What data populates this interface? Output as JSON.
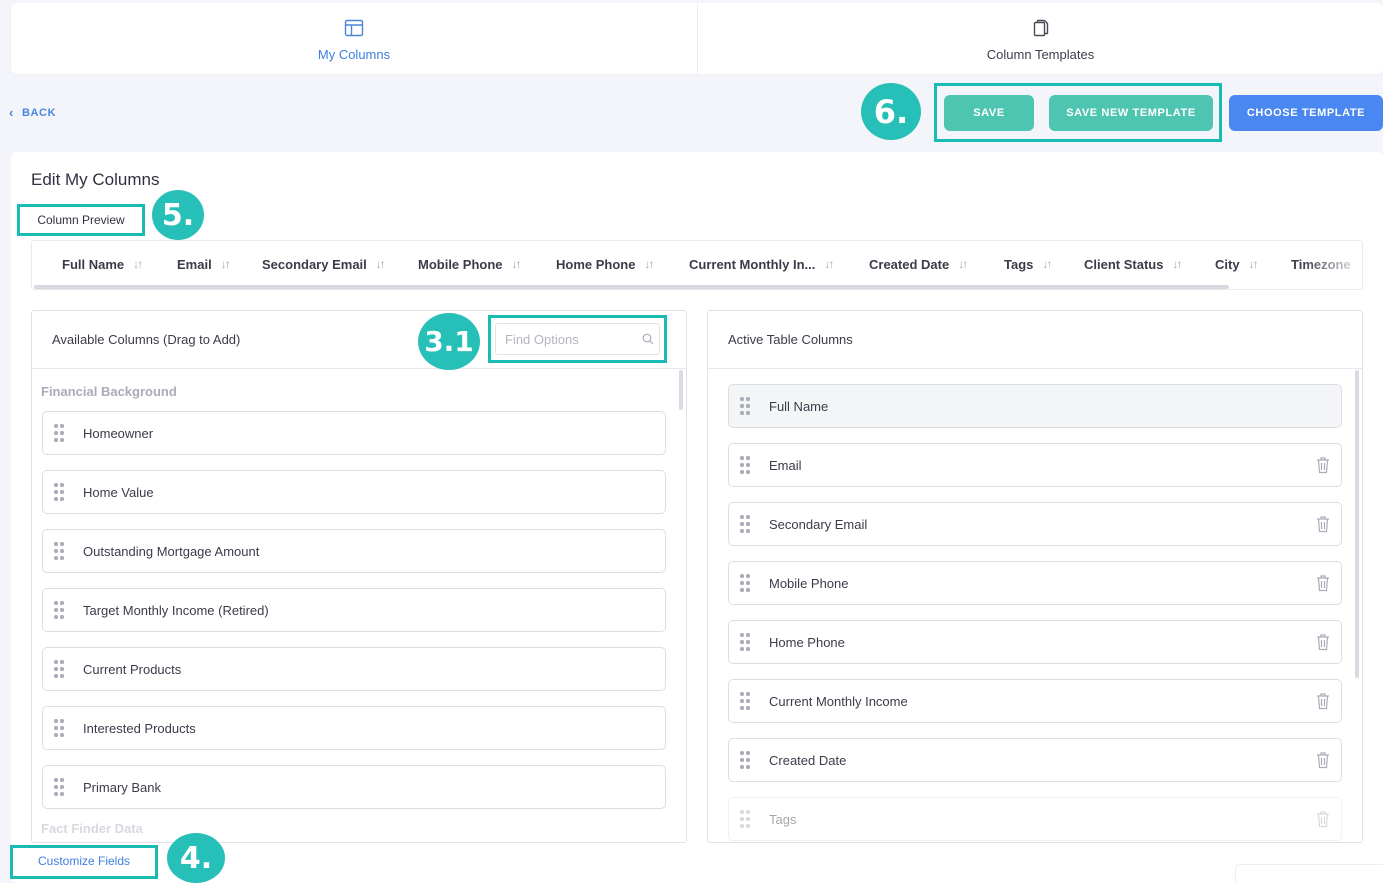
{
  "tabs": [
    {
      "label": "My Columns",
      "icon": "layout-icon",
      "active": true
    },
    {
      "label": "Column Templates",
      "icon": "copy-icon",
      "active": false
    }
  ],
  "back_label": "BACK",
  "actions": {
    "save": "SAVE",
    "save_new_template": "SAVE NEW TEMPLATE",
    "choose_template": "CHOOSE TEMPLATE"
  },
  "page_title": "Edit My Columns",
  "preview_label": "Column Preview",
  "preview_columns": [
    "Full Name",
    "Email",
    "Secondary Email",
    "Mobile Phone",
    "Home Phone",
    "Current Monthly In...",
    "Created Date",
    "Tags",
    "Client Status",
    "City",
    "Timezone"
  ],
  "available": {
    "title": "Available Columns (Drag to Add)",
    "search_placeholder": "Find Options",
    "group": "Financial Background",
    "items": [
      "Homeowner",
      "Home Value",
      "Outstanding Mortgage Amount",
      "Target Monthly Income (Retired)",
      "Current Products",
      "Interested Products",
      "Primary Bank"
    ],
    "next_group": "Fact Finder Data"
  },
  "active": {
    "title": "Active Table Columns",
    "items": [
      "Full Name",
      "Email",
      "Secondary Email",
      "Mobile Phone",
      "Home Phone",
      "Current Monthly Income",
      "Created Date",
      "Tags"
    ]
  },
  "customize_fields": "Customize Fields",
  "annotations": [
    "6.",
    "5.",
    "3.1",
    "4."
  ],
  "colors": {
    "accent_blue": "#4a87f0",
    "accent_teal": "#4dc5b1",
    "highlight": "#18bcb3",
    "link_blue": "#3d7fe0"
  }
}
